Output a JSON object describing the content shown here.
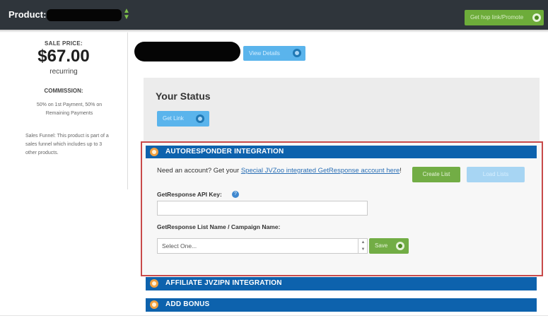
{
  "header": {
    "product_label": "Product:",
    "product_name": "[redacted]",
    "top_button_label": "Get hop link/Promote"
  },
  "sidebar": {
    "sale_price_label": "SALE PRICE:",
    "price": "$67.00",
    "price_type": "recurring",
    "commission_label": "COMMISSION:",
    "commission_text": "50% on 1st Payment, 50% on Remaining Payments",
    "funnel_text": "Sales Funnel: This product is part of a sales funnel which includes up to 3 other products."
  },
  "main": {
    "product_title": "[redacted]",
    "view_details_label": "View Details",
    "status": {
      "title": "Your Status",
      "button_label": "Get Link"
    },
    "autoresponder": {
      "header": "AUTORESPONDER INTEGRATION",
      "account_prompt": "Need an account? Get your",
      "account_link": "Special JVZoo integrated GetResponse account here",
      "account_suffix": "!",
      "create_list_label": "Create List",
      "secondary_button_label": "Load Lists",
      "api_key_label": "GetResponse API Key:",
      "api_key_value": "",
      "help_icon_text": "?",
      "list_label": "GetResponse List Name / Campaign Name:",
      "list_selected": "Select One...",
      "save_label": "Save"
    },
    "affiliate_header": "AFFILIATE JVZIPN INTEGRATION",
    "bonus_header": "ADD BONUS"
  },
  "colors": {
    "topbar": "#2f353b",
    "accent_blue": "#0d62ad",
    "button_green": "#6dac3a",
    "button_light_blue": "#5ab4ec",
    "highlight_border": "#c84a4a"
  },
  "icons": [
    "chevron-switch-icon",
    "circle-arrow-icon",
    "circle-arrow-icon",
    "circle-arrow-icon",
    "help-icon",
    "section-toggle-icon"
  ]
}
